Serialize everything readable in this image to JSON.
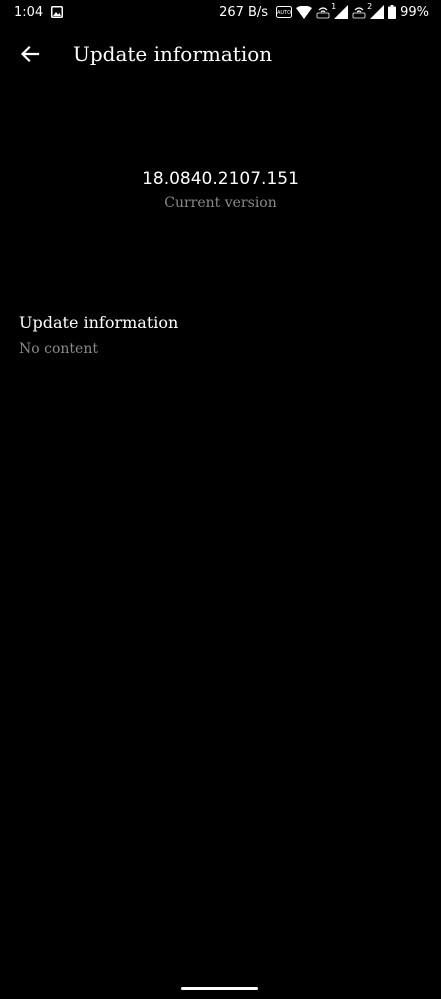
{
  "status_bar": {
    "time": "1:04",
    "net_speed": "267 B/s",
    "battery": "99%",
    "sim1_badge": "1",
    "sim2_badge": "2",
    "icons": [
      "gallery-icon",
      "auto-sync-icon",
      "wifi-icon",
      "volte-icon",
      "signal-icon",
      "battery-icon"
    ]
  },
  "app_bar": {
    "title": "Update information",
    "back_icon": "arrow-left-icon"
  },
  "version": {
    "number": "18.0840.2107.151",
    "label": "Current version"
  },
  "info": {
    "heading": "Update information",
    "body": "No content"
  },
  "colors": {
    "background": "#000000",
    "primary_text": "#ffffff",
    "secondary_text": "#8a8a8a"
  }
}
